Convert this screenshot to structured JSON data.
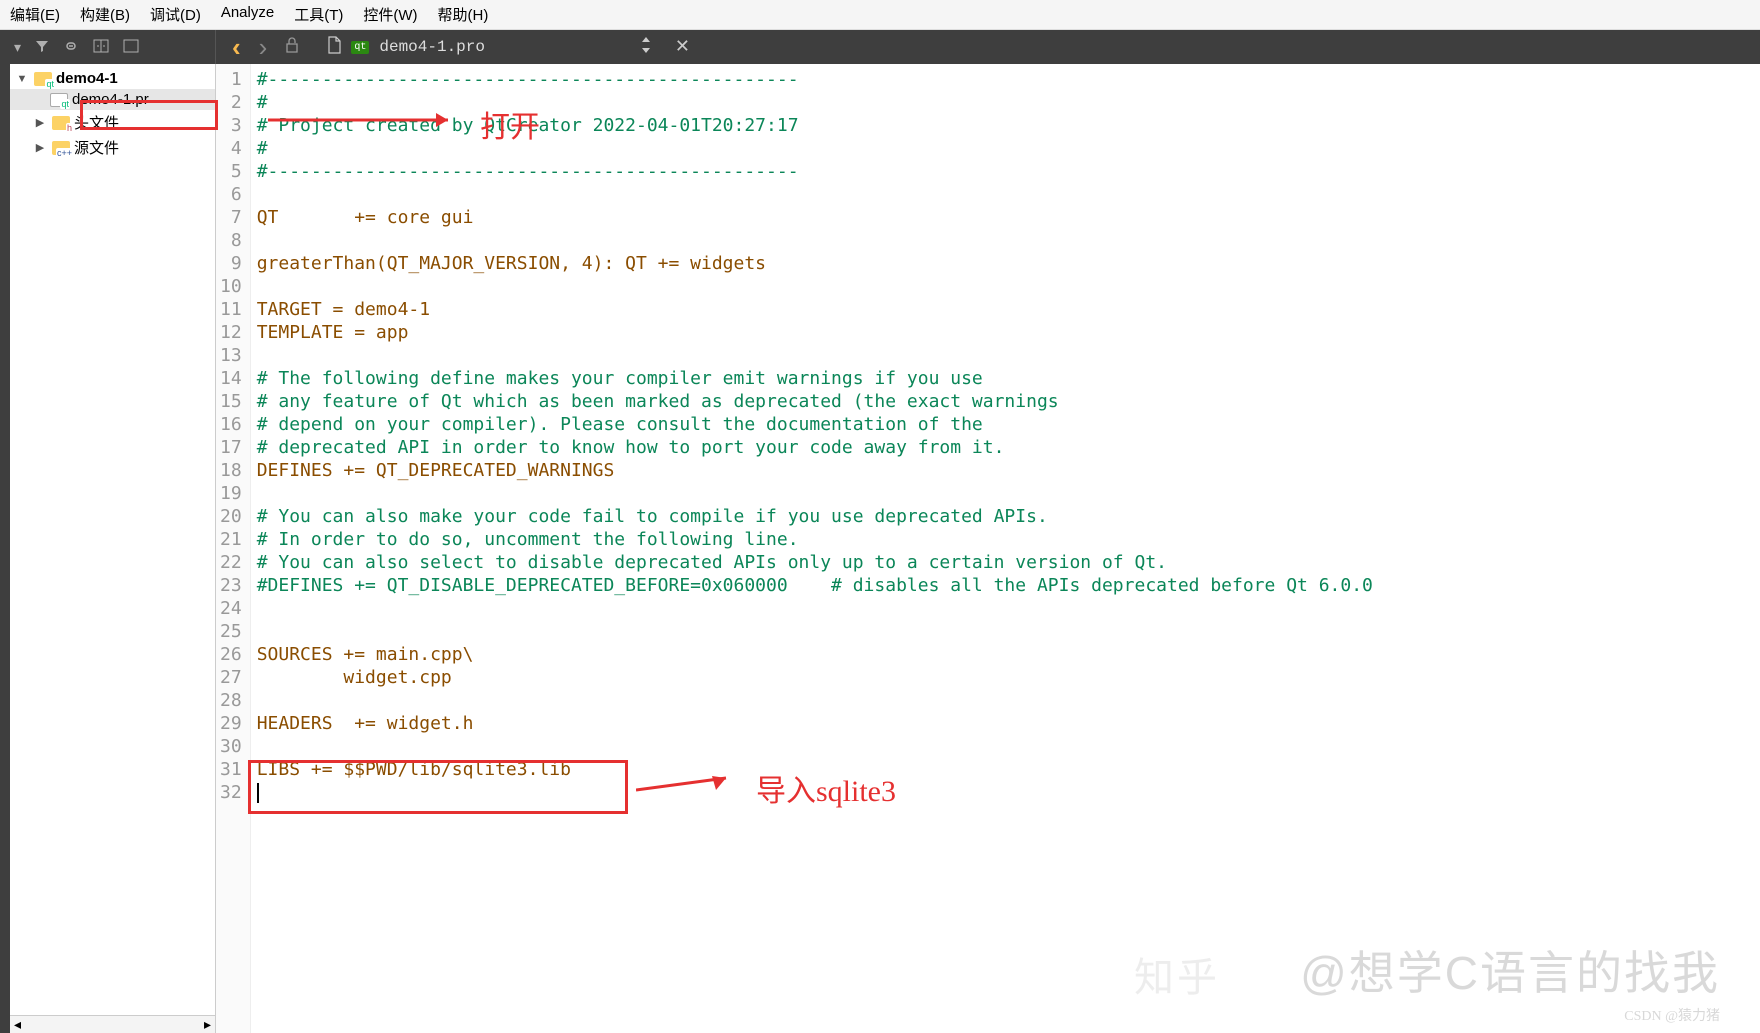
{
  "menu": {
    "edit": "编辑(E)",
    "build": "构建(B)",
    "debug": "调试(D)",
    "analyze": "Analyze",
    "tools": "工具(T)",
    "widgets": "控件(W)",
    "help": "帮助(H)"
  },
  "toolbar": {
    "filter_icon": "▾",
    "funnel_icon": "▼",
    "link_icon": "⟲",
    "split_icon": "⊞",
    "screen_icon": "▭"
  },
  "nav": {
    "back": "‹",
    "forward": "›",
    "lock_icon": "🔓",
    "file_icon": "🗎",
    "qt_badge": "qt",
    "filename": "demo4-1.pro",
    "split_icon": "⇵",
    "close_icon": "✕"
  },
  "tree": {
    "root": {
      "label": "demo4-1",
      "badge": "qt"
    },
    "pro_file": {
      "label": "demo4-1.pr",
      "badge": "qt"
    },
    "headers": {
      "label": "头文件",
      "badge": "h"
    },
    "sources": {
      "label": "源文件",
      "badge": "c++"
    }
  },
  "code_lines": [
    {
      "n": 1,
      "cls": "comment",
      "t": "#-------------------------------------------------"
    },
    {
      "n": 2,
      "cls": "comment",
      "t": "#"
    },
    {
      "n": 3,
      "cls": "comment",
      "t": "# Project created by QtCreator 2022-04-01T20:27:17"
    },
    {
      "n": 4,
      "cls": "comment",
      "t": "#"
    },
    {
      "n": 5,
      "cls": "comment",
      "t": "#-------------------------------------------------"
    },
    {
      "n": 6,
      "cls": "",
      "t": ""
    },
    {
      "n": 7,
      "cls": "kw",
      "t": "QT       += core gui"
    },
    {
      "n": 8,
      "cls": "",
      "t": ""
    },
    {
      "n": 9,
      "cls": "kw",
      "t": "greaterThan(QT_MAJOR_VERSION, 4): QT += widgets"
    },
    {
      "n": 10,
      "cls": "",
      "t": ""
    },
    {
      "n": 11,
      "cls": "kw",
      "t": "TARGET = demo4-1"
    },
    {
      "n": 12,
      "cls": "kw",
      "t": "TEMPLATE = app"
    },
    {
      "n": 13,
      "cls": "",
      "t": ""
    },
    {
      "n": 14,
      "cls": "comment",
      "t": "# The following define makes your compiler emit warnings if you use"
    },
    {
      "n": 15,
      "cls": "comment",
      "t": "# any feature of Qt which as been marked as deprecated (the exact warnings"
    },
    {
      "n": 16,
      "cls": "comment",
      "t": "# depend on your compiler). Please consult the documentation of the"
    },
    {
      "n": 17,
      "cls": "comment",
      "t": "# deprecated API in order to know how to port your code away from it."
    },
    {
      "n": 18,
      "cls": "kw",
      "t": "DEFINES += QT_DEPRECATED_WARNINGS"
    },
    {
      "n": 19,
      "cls": "",
      "t": ""
    },
    {
      "n": 20,
      "cls": "comment",
      "t": "# You can also make your code fail to compile if you use deprecated APIs."
    },
    {
      "n": 21,
      "cls": "comment",
      "t": "# In order to do so, uncomment the following line."
    },
    {
      "n": 22,
      "cls": "comment",
      "t": "# You can also select to disable deprecated APIs only up to a certain version of Qt."
    },
    {
      "n": 23,
      "cls": "comment",
      "t": "#DEFINES += QT_DISABLE_DEPRECATED_BEFORE=0x060000    # disables all the APIs deprecated before Qt 6.0.0"
    },
    {
      "n": 24,
      "cls": "",
      "t": ""
    },
    {
      "n": 25,
      "cls": "",
      "t": ""
    },
    {
      "n": 26,
      "cls": "kw",
      "t": "SOURCES += main.cpp\\"
    },
    {
      "n": 27,
      "cls": "kw",
      "t": "        widget.cpp"
    },
    {
      "n": 28,
      "cls": "",
      "t": ""
    },
    {
      "n": 29,
      "cls": "kw",
      "t": "HEADERS  += widget.h"
    },
    {
      "n": 30,
      "cls": "",
      "t": ""
    },
    {
      "n": 31,
      "cls": "kw",
      "t": "LIBS += $$PWD/lib/sqlite3.lib"
    },
    {
      "n": 32,
      "cls": "",
      "t": ""
    }
  ],
  "annotations": {
    "open_label": "打开",
    "import_label": "导入sqlite3"
  },
  "watermarks": {
    "zhihu": "知乎",
    "main": "@想学C语言的找我",
    "csdn": "CSDN @猿力猪"
  }
}
